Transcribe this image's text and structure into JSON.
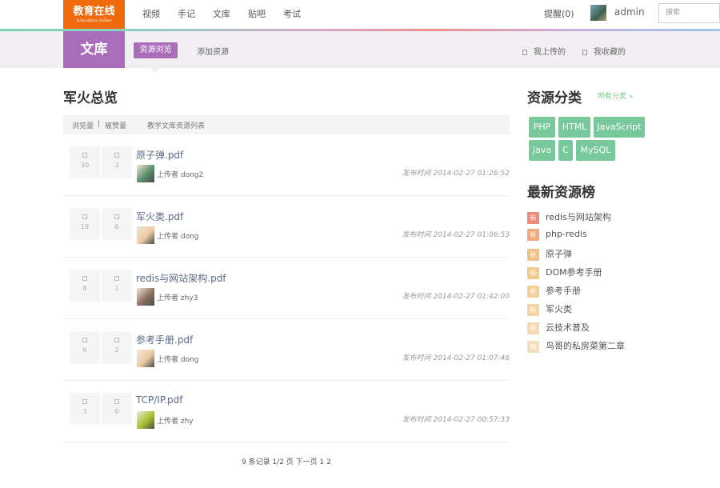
{
  "header": {
    "logo": "教育在线",
    "logo_sub": "Education Online",
    "nav": [
      "视频",
      "手记",
      "文库",
      "贴吧",
      "考试"
    ],
    "remind": "提醒(0)",
    "username": "admin",
    "search_placeholder": "搜索"
  },
  "subheader": {
    "section": "文库",
    "tabs": [
      "资源浏览",
      "添加资源"
    ],
    "my_uploads": "我上传的",
    "my_favorites": "我收藏的"
  },
  "main": {
    "title": "军火总览",
    "sort": {
      "views": "浏览量",
      "sep": "|",
      "likes": "被赞量",
      "list_label": "教学文库资源列表"
    },
    "items": [
      {
        "views": "30",
        "likes": "3",
        "file": "原子弹.pdf",
        "uploader": "上传者 dong2",
        "time": "发布时间 2014-02-27 01:26:52",
        "avatar_color": "#5a8c6a"
      },
      {
        "views": "19",
        "likes": "6",
        "file": "军火类.pdf",
        "uploader": "上传者 dong",
        "time": "发布时间 2014-02-27 01:06:53",
        "avatar_color": "#e9c9a4"
      },
      {
        "views": "8",
        "likes": "1",
        "file": "redis与网站架构.pdf",
        "uploader": "上传者 zhy3",
        "time": "发布时间 2014-02-27 01:42:00",
        "avatar_color": "#8a7060"
      },
      {
        "views": "6",
        "likes": "2",
        "file": "参考手册.pdf",
        "uploader": "上传者 dong",
        "time": "发布时间 2014-02-27 01:07:46",
        "avatar_color": "#e9c9a4"
      },
      {
        "views": "3",
        "likes": "0",
        "file": "TCP/IP.pdf",
        "uploader": "上传者 zhy",
        "time": "发布时间 2014-02-27 00:57:33",
        "avatar_color": "#a6c22e"
      }
    ],
    "pager": "9 条记录 1/2 页 下一页 1 2"
  },
  "sidebar": {
    "category_title": "资源分类",
    "all_categories": "所有分类 »",
    "tags": [
      "PHP",
      "HTML",
      "JavaScript",
      "Java",
      "C",
      "MySQL"
    ],
    "ranking_title": "最新资源榜",
    "badge_label": "新",
    "ranking": [
      {
        "name": "redis与网站架构",
        "color": "#f08a7a"
      },
      {
        "name": "php-redis",
        "color": "#f4a97a"
      },
      {
        "name": "原子弹",
        "color": "#f4bf82"
      },
      {
        "name": "DOM参考手册",
        "color": "#f4c98c"
      },
      {
        "name": "参考手册",
        "color": "#f4cf98"
      },
      {
        "name": "军火类",
        "color": "#f4d4a4"
      },
      {
        "name": "云技术普及",
        "color": "#f4dab0"
      },
      {
        "name": "鸟哥的私房菜第二章",
        "color": "#f4dfbc"
      }
    ]
  }
}
